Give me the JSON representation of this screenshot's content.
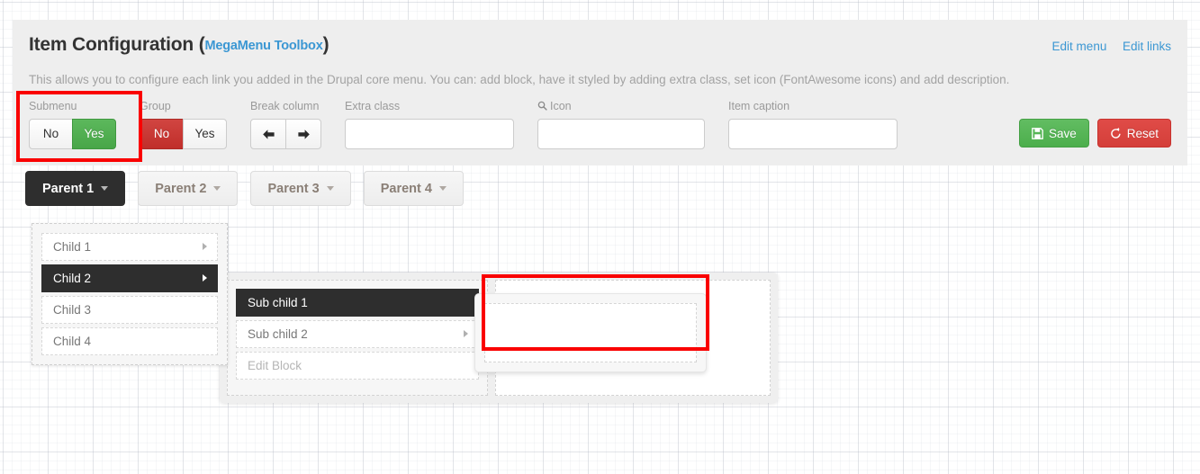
{
  "header": {
    "title": "Item Configuration",
    "paren_open": "(",
    "module_link": "MegaMenu Toolbox",
    "paren_close": ")",
    "edit_menu_link": "Edit menu",
    "edit_links_link": "Edit links",
    "description": "This allows you to configure each link you added in the Drupal core menu. You can: add block, have it styled by adding extra class, set icon (FontAwesome icons) and add description."
  },
  "controls": {
    "submenu": {
      "label": "Submenu",
      "options": [
        "No",
        "Yes"
      ],
      "selected": "Yes",
      "selected_color": "#5cb85c"
    },
    "group": {
      "label": "Group",
      "options": [
        "No",
        "Yes"
      ],
      "selected": "No",
      "selected_color": "#c9302c"
    },
    "break_column": {
      "label": "Break column",
      "left_icon": "arrow-left-icon",
      "right_icon": "arrow-right-icon"
    },
    "extra_class": {
      "label": "Extra class",
      "value": "",
      "placeholder": ""
    },
    "icon": {
      "label": "Icon",
      "label_icon": "search-icon",
      "value": "",
      "placeholder": ""
    },
    "item_caption": {
      "label": "Item caption",
      "value": "",
      "placeholder": ""
    },
    "save": {
      "label": "Save",
      "icon": "floppy-disk-icon",
      "color": "#4cae4c"
    },
    "reset": {
      "label": "Reset",
      "icon": "undo-arrow-icon",
      "color": "#d43f3a"
    }
  },
  "preview": {
    "parents": [
      {
        "label": "Parent 1",
        "active": true
      },
      {
        "label": "Parent 2",
        "active": false
      },
      {
        "label": "Parent 3",
        "active": false
      },
      {
        "label": "Parent 4",
        "active": false
      }
    ],
    "children": [
      {
        "label": "Child 1",
        "active": false,
        "has_caret": true
      },
      {
        "label": "Child 2",
        "active": true,
        "has_caret": true
      },
      {
        "label": "Child 3",
        "active": false,
        "has_caret": false
      },
      {
        "label": "Child 4",
        "active": false,
        "has_caret": false
      }
    ],
    "sub_children": [
      {
        "label": "Sub child 1",
        "active": true,
        "has_caret": false,
        "dim": false
      },
      {
        "label": "Sub child 2",
        "active": false,
        "has_caret": true,
        "dim": false
      },
      {
        "label": "Edit Block",
        "active": false,
        "has_caret": false,
        "dim": true
      }
    ]
  },
  "annotations": {
    "submenu_highlight_color": "#fa0000",
    "block_highlight_color": "#fa0000"
  }
}
